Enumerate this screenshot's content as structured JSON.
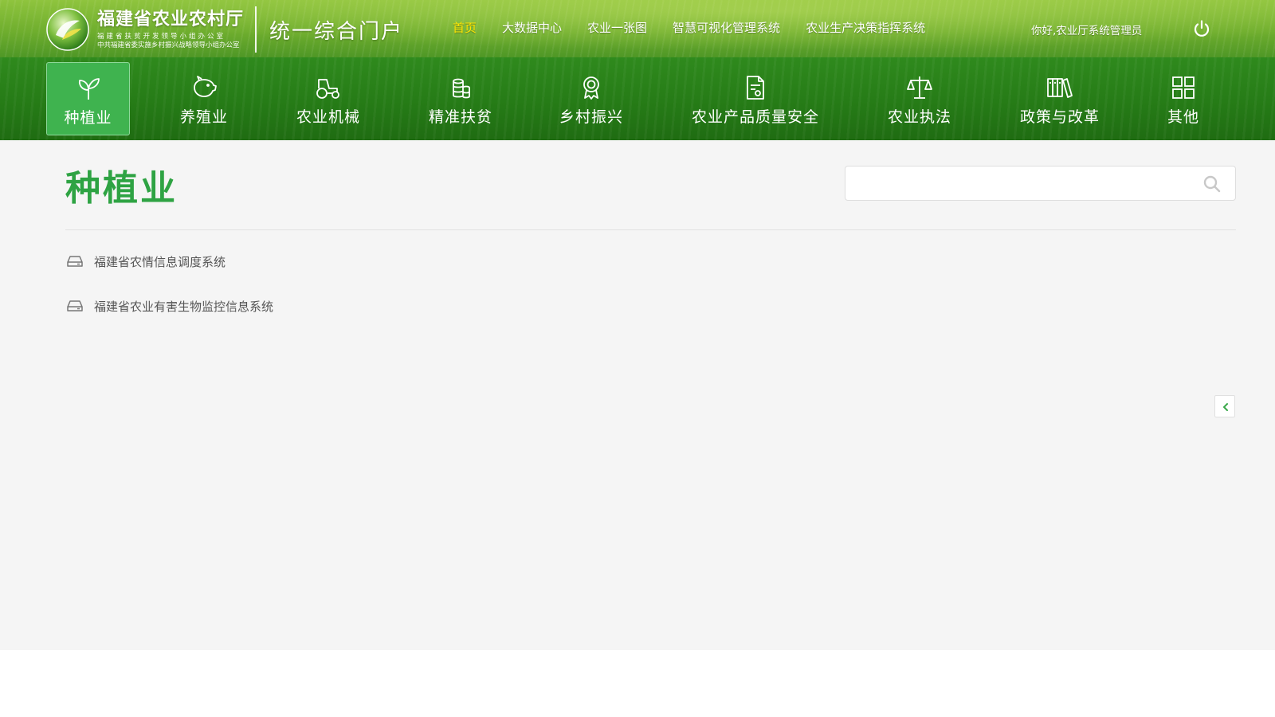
{
  "header": {
    "org_title": "福建省农业农村厅",
    "org_subtitle_1": "福建省扶贫开发领导小组办公室",
    "org_subtitle_2": "中共福建省委实施乡村振兴战略领导小组办公室",
    "portal_title": "统一综合门户",
    "links": [
      {
        "label": "首页",
        "active": true
      },
      {
        "label": "大数据中心",
        "active": false
      },
      {
        "label": "农业一张图",
        "active": false
      },
      {
        "label": "智慧可视化管理系统",
        "active": false
      },
      {
        "label": "农业生产决策指挥系统",
        "active": false
      }
    ],
    "greeting": "你好,农业厅系统管理员",
    "logout_icon": "power-icon",
    "accent_active_link": "#ffe600"
  },
  "nav": {
    "items": [
      {
        "label": "种植业",
        "icon": "sprout-icon",
        "active": true
      },
      {
        "label": "养殖业",
        "icon": "pig-icon",
        "active": false
      },
      {
        "label": "农业机械",
        "icon": "tractor-icon",
        "active": false
      },
      {
        "label": "精准扶贫",
        "icon": "coins-icon",
        "active": false
      },
      {
        "label": "乡村振兴",
        "icon": "award-icon",
        "active": false
      },
      {
        "label": "农业产品质量安全",
        "icon": "certificate-icon",
        "active": false
      },
      {
        "label": "农业执法",
        "icon": "scale-icon",
        "active": false
      },
      {
        "label": "政策与改革",
        "icon": "books-icon",
        "active": false
      },
      {
        "label": "其他",
        "icon": "grid-icon",
        "active": false
      }
    ]
  },
  "main": {
    "title": "种植业",
    "search": {
      "value": "",
      "placeholder": ""
    },
    "systems": [
      {
        "label": "福建省农情信息调度系统",
        "icon": "drive-icon"
      },
      {
        "label": "福建省农业有害生物监控信息系统",
        "icon": "drive-icon"
      }
    ],
    "sidebar_toggle_icon": "chevron-left-icon"
  },
  "colors": {
    "title_green": "#2ea343",
    "nav_green": "#257a16",
    "active_tab": "#3fb34f"
  }
}
